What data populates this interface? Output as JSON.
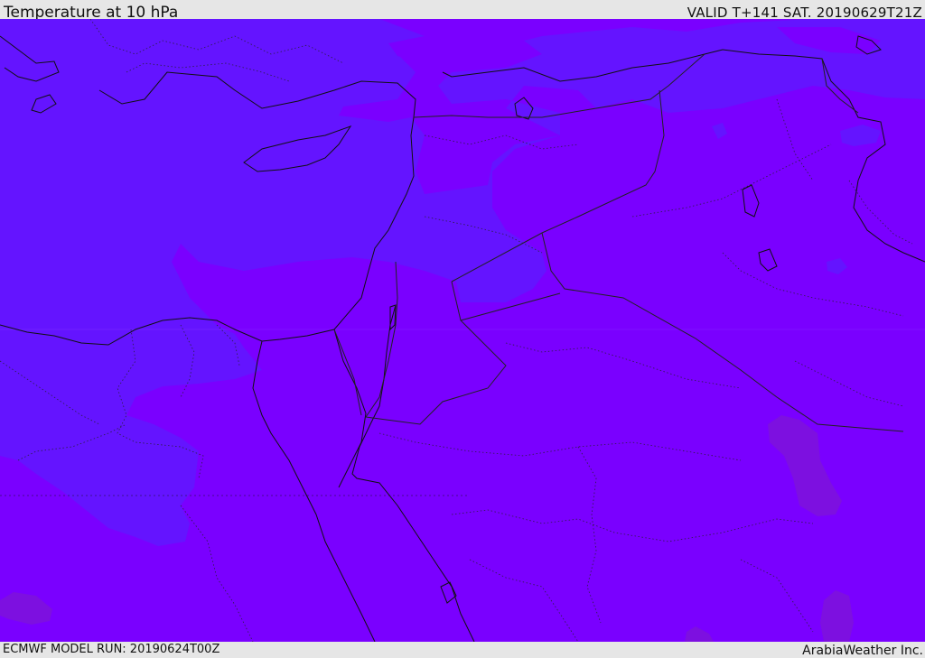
{
  "header": {
    "title": "Temperature at 10 hPa",
    "valid_time": "VALID T+141 SAT. 20190629T21Z"
  },
  "footer": {
    "model_run": "ECMWF MODEL RUN: 20190624T00Z",
    "credit": "ArabiaWeather Inc."
  },
  "map": {
    "colors": {
      "base_field": "#7a00ff",
      "cool_field": "#6414ff",
      "warm_patch": "#7d10e0",
      "coastline": "#111111",
      "border": "#222222"
    }
  }
}
